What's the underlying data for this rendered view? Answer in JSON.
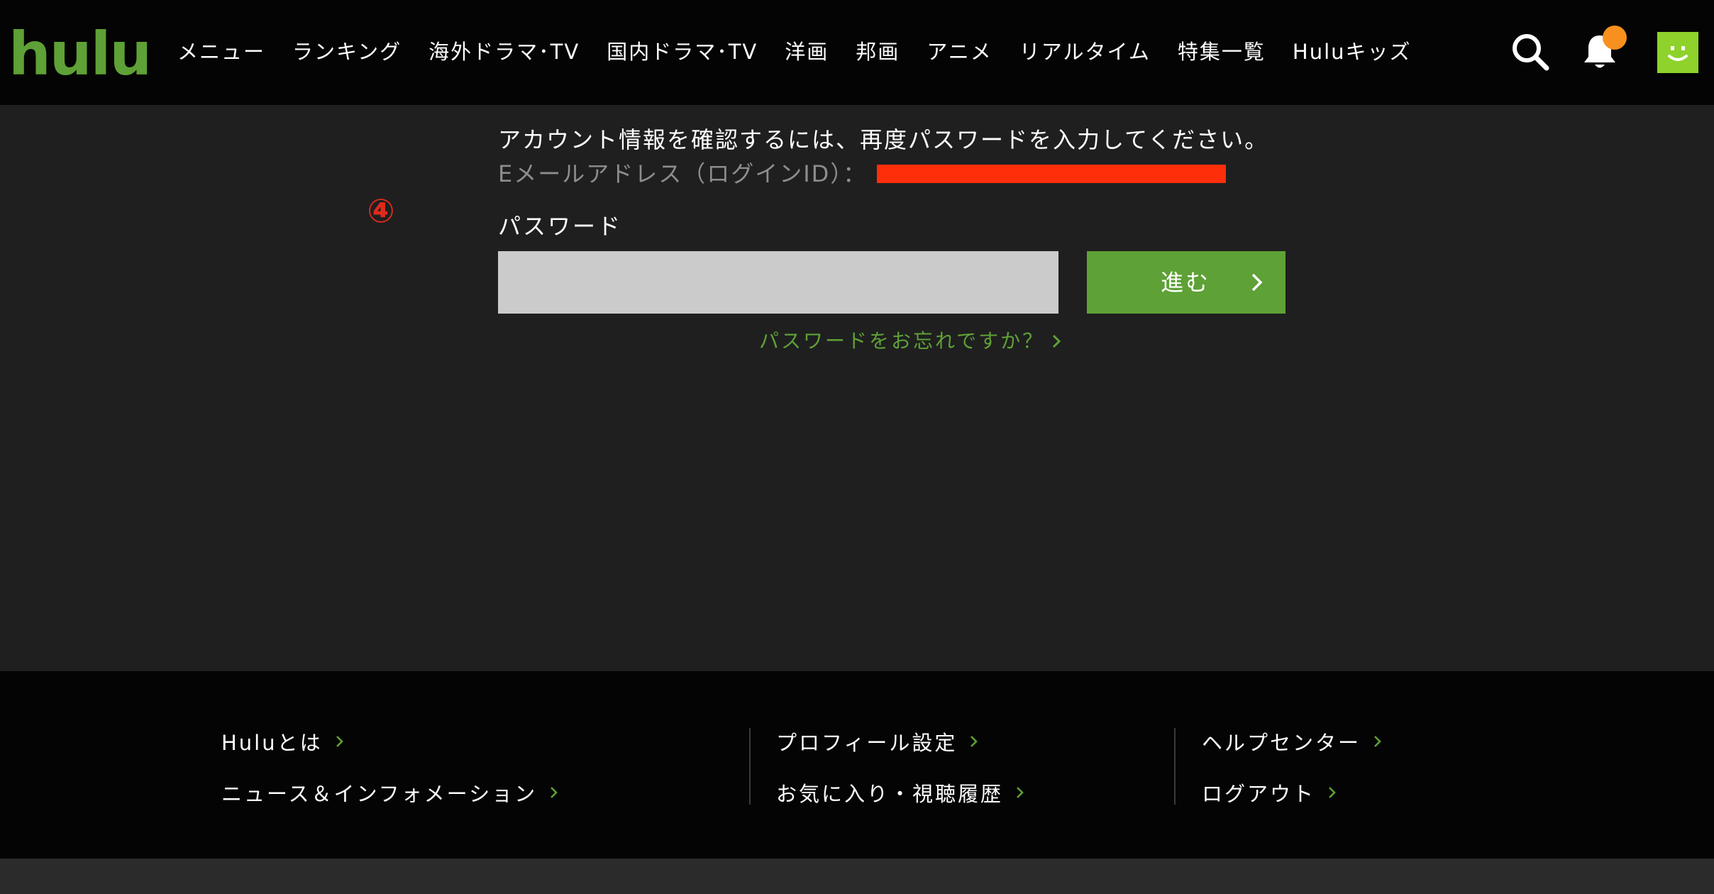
{
  "header": {
    "logo": "hulu",
    "nav": [
      "メニュー",
      "ランキング",
      "海外ドラマ･TV",
      "国内ドラマ･TV",
      "洋画",
      "邦画",
      "アニメ",
      "リアルタイム",
      "特集一覧",
      "Huluキッズ"
    ]
  },
  "main": {
    "step_marker": "④",
    "info_text": "アカウント情報を確認するには、再度パスワードを入力してください。",
    "email_label": "Eメールアドレス（ログインID）：",
    "password_label": "パスワード",
    "password_value": "",
    "next_button_label": "進む",
    "forgot_link": "パスワードをお忘れですか？"
  },
  "footer": {
    "col1": [
      "Huluとは",
      "ニュース＆インフォメーション"
    ],
    "col2": [
      "プロフィール設定",
      "お気に入り・視聴履歴"
    ],
    "col3": [
      "ヘルプセンター",
      "ログアウト"
    ]
  },
  "colors": {
    "brand_green": "#5ea136",
    "notification_dot": "#f7901e",
    "avatar": "#8ed22b",
    "redaction": "#fe2e0a",
    "marker": "#e02a1c"
  },
  "icons": {
    "search": "search-icon",
    "notifications": "bell-icon",
    "profile": "avatar-icon",
    "chevron": "chevron-right-icon"
  }
}
